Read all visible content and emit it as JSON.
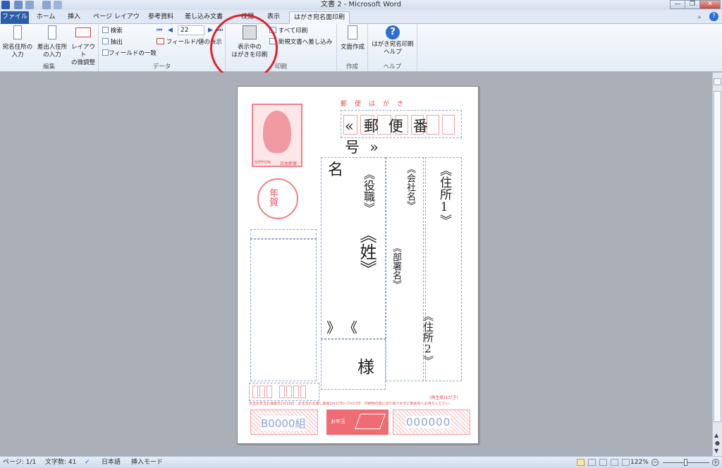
{
  "window": {
    "title": "文書 2 - Microsoft Word"
  },
  "tabs": [
    "ファイル",
    "ホーム",
    "挿入",
    "ページ レイアウト",
    "参考資料",
    "差し込み文書",
    "校閲",
    "表示",
    "はがき宛名面印刷"
  ],
  "ribbon": {
    "edit": {
      "b1a": "宛名住所の",
      "b1b": "入力",
      "b2a": "差出人住所",
      "b2b": "の入力",
      "b3a": "レイアウト",
      "b3b": "の微調整",
      "label": "編集"
    },
    "data": {
      "search": "検索",
      "extract": "抽出",
      "fieldmatch": "フィールドの一致",
      "record": "22",
      "fieldview": "フィールド/値の表示",
      "label": "データ"
    },
    "print": {
      "printa": "表示中の",
      "printb": "はがきを印刷",
      "printall": "すべて印刷",
      "newdoc": "新規文書へ差し込み",
      "label": "印刷"
    },
    "create": {
      "btn": "文面作成",
      "label": "作成"
    },
    "help": {
      "btna": "はがき宛名印刷",
      "btnb": "ヘルプ",
      "label": "ヘルプ"
    }
  },
  "card": {
    "header": "郵　便　は　が　き",
    "postal": "«郵便番号»",
    "brand": "NIPPON",
    "brand2": "日本郵便",
    "nenga": "年賀",
    "address1": "《住所1》",
    "address2": "《住所2》",
    "company": "《会社名》",
    "dept": "《部署名》",
    "title": "《役職》",
    "mei": "名",
    "surname": "《姓》",
    "chev": "》《",
    "sama": "様",
    "recycle": "(再生紙はがき)",
    "notice": "年玉お年玉お抽選日1月19日　お年玉のお渡し期間1月17日～7月17日　印刷物の紙に切り取りせずに郵便局へお持ちください。",
    "group": "B0000組",
    "number": "000000",
    "stamp": "お年玉"
  },
  "status": {
    "page": "ページ: 1/1",
    "words": "文字数: 41",
    "lang": "日本語",
    "mode": "挿入モード",
    "zoom": "122%"
  }
}
